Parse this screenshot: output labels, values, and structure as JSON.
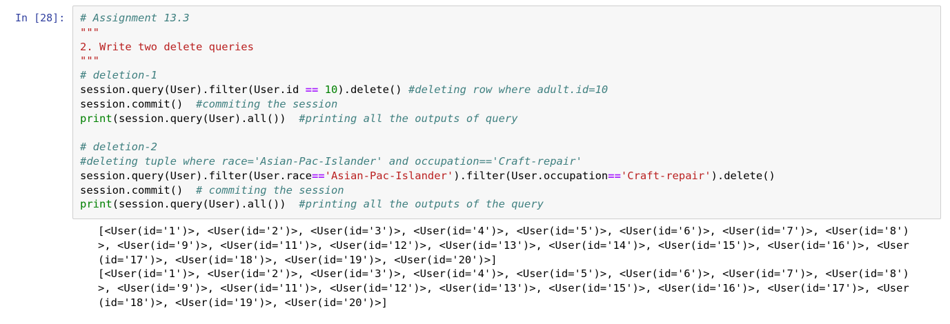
{
  "cell": {
    "prompt": "In [28]:",
    "code_lines": [
      [
        {
          "t": "# Assignment 13.3",
          "c": "c"
        }
      ],
      [
        {
          "t": "\"\"\"",
          "c": "s"
        }
      ],
      [
        {
          "t": "2. Write two delete queries",
          "c": "s"
        }
      ],
      [
        {
          "t": "\"\"\"",
          "c": "s"
        }
      ],
      [
        {
          "t": "# deletion-1",
          "c": "c"
        }
      ],
      [
        {
          "t": "session.query(User).filter(User.id ",
          "c": ""
        },
        {
          "t": "==",
          "c": "o"
        },
        {
          "t": " ",
          "c": ""
        },
        {
          "t": "10",
          "c": "n"
        },
        {
          "t": ").delete() ",
          "c": ""
        },
        {
          "t": "#deleting row where adult.id=10",
          "c": "c"
        }
      ],
      [
        {
          "t": "session.commit()  ",
          "c": ""
        },
        {
          "t": "#commiting the session",
          "c": "c"
        }
      ],
      [
        {
          "t": "print",
          "c": "b"
        },
        {
          "t": "(session.query(User).all())  ",
          "c": ""
        },
        {
          "t": "#printing all the outputs of query",
          "c": "c"
        }
      ],
      [
        {
          "t": "",
          "c": ""
        }
      ],
      [
        {
          "t": "# deletion-2",
          "c": "c"
        }
      ],
      [
        {
          "t": "#deleting tuple where race='Asian-Pac-Islander' and occupation=='Craft-repair'",
          "c": "c"
        }
      ],
      [
        {
          "t": "session.query(User).filter(User.race",
          "c": ""
        },
        {
          "t": "==",
          "c": "o"
        },
        {
          "t": "'Asian-Pac-Islander'",
          "c": "s"
        },
        {
          "t": ").filter(User.occupation",
          "c": ""
        },
        {
          "t": "==",
          "c": "o"
        },
        {
          "t": "'Craft-repair'",
          "c": "s"
        },
        {
          "t": ").delete()",
          "c": ""
        }
      ],
      [
        {
          "t": "session.commit()  ",
          "c": ""
        },
        {
          "t": "# commiting the session",
          "c": "c"
        }
      ],
      [
        {
          "t": "print",
          "c": "b"
        },
        {
          "t": "(session.query(User).all())  ",
          "c": ""
        },
        {
          "t": "#printing all the outputs of the query",
          "c": "c"
        }
      ]
    ],
    "output_lines": [
      "[<User(id='1')>, <User(id='2')>, <User(id='3')>, <User(id='4')>, <User(id='5')>, <User(id='6')>, <User(id='7')>, <User(id='8')",
      ">, <User(id='9')>, <User(id='11')>, <User(id='12')>, <User(id='13')>, <User(id='14')>, <User(id='15')>, <User(id='16')>, <User",
      "(id='17')>, <User(id='18')>, <User(id='19')>, <User(id='20')>]",
      "[<User(id='1')>, <User(id='2')>, <User(id='3')>, <User(id='4')>, <User(id='5')>, <User(id='6')>, <User(id='7')>, <User(id='8')",
      ">, <User(id='9')>, <User(id='11')>, <User(id='12')>, <User(id='13')>, <User(id='15')>, <User(id='16')>, <User(id='17')>, <User",
      "(id='18')>, <User(id='19')>, <User(id='20')>]"
    ]
  }
}
